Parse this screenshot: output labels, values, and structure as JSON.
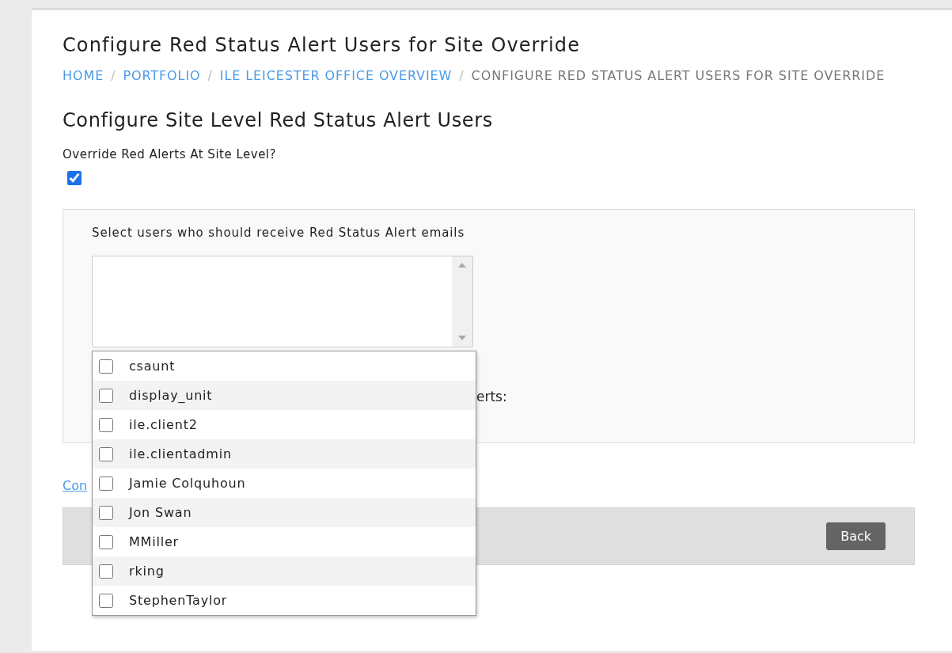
{
  "title": "Configure Red Status Alert Users for Site Override",
  "breadcrumb": [
    {
      "label": "HOME",
      "kind": "link",
      "separator": "/"
    },
    {
      "label": "PORTFOLIO",
      "kind": "link",
      "separator": "/"
    },
    {
      "label": "ILE LEICESTER OFFICE OVERVIEW",
      "kind": "link",
      "separator": "/"
    },
    {
      "label": "CONFIGURE RED STATUS ALERT USERS FOR SITE OVERRIDE",
      "kind": "current"
    }
  ],
  "section_title": "Configure Site Level Red Status Alert Users",
  "override": {
    "label": "Override Red Alerts At Site Level?",
    "checked": true
  },
  "panel": {
    "label": "Select users who should receive Red Status Alert emails",
    "partial_label": "erts:"
  },
  "user_options": [
    {
      "label": "csaunt",
      "checked": false
    },
    {
      "label": "display_unit",
      "checked": false
    },
    {
      "label": "ile.client2",
      "checked": false
    },
    {
      "label": "ile.clientadmin",
      "checked": false
    },
    {
      "label": "Jamie Colquhoun",
      "checked": false
    },
    {
      "label": "Jon Swan",
      "checked": false
    },
    {
      "label": "MMiller",
      "checked": false
    },
    {
      "label": "rking",
      "checked": false
    },
    {
      "label": "StephenTaylor",
      "checked": false
    }
  ],
  "partial_link": "Con",
  "buttons": [
    "Back"
  ]
}
